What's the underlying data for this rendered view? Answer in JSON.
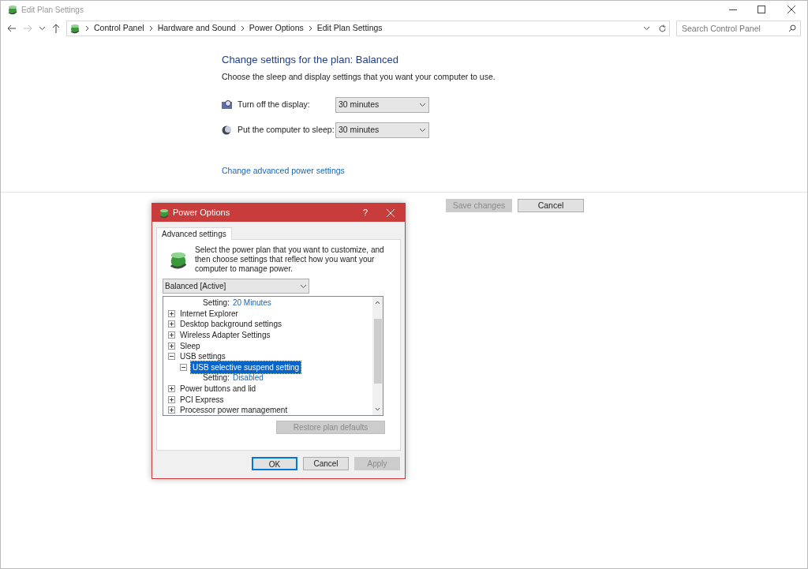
{
  "window": {
    "title": "Edit Plan Settings"
  },
  "breadcrumb": [
    "Control Panel",
    "Hardware and Sound",
    "Power Options",
    "Edit Plan Settings"
  ],
  "search": {
    "placeholder": "Search Control Panel"
  },
  "heading": "Change settings for the plan: Balanced",
  "subheading": "Choose the sleep and display settings that you want your computer to use.",
  "settings": [
    {
      "kind": "display",
      "label": "Turn off the display:",
      "value": "30 minutes"
    },
    {
      "kind": "sleep",
      "label": "Put the computer to sleep:",
      "value": "30 minutes"
    }
  ],
  "advanced_link": "Change advanced power settings",
  "buttons": [
    {
      "label": "Save changes",
      "disabled": true
    },
    {
      "label": "Cancel",
      "disabled": false
    }
  ],
  "dialog": {
    "title": "Power Options",
    "help": "?",
    "tabs": [
      {
        "label": "Advanced settings",
        "selected": true
      }
    ],
    "intro": "Select the power plan that you want to customize, and then choose settings that reflect how you want your computer to manage power.",
    "plan": "Balanced [Active]",
    "tree": [
      {
        "kind": "setting",
        "label": "Setting:",
        "value": "20 Minutes"
      },
      {
        "kind": "node",
        "label": "Internet Explorer",
        "expanded": false,
        "selected": false
      },
      {
        "kind": "node",
        "label": "Desktop background settings",
        "expanded": false,
        "selected": false
      },
      {
        "kind": "node",
        "label": "Wireless Adapter Settings",
        "expanded": false,
        "selected": false
      },
      {
        "kind": "node",
        "label": "Sleep",
        "expanded": false,
        "selected": false
      },
      {
        "kind": "node",
        "label": "USB settings",
        "expanded": true,
        "selected": false,
        "children": [
          {
            "kind": "node",
            "label": "USB selective suspend setting",
            "expanded": true,
            "selected": true,
            "children": [
              {
                "kind": "setting",
                "label": "Setting:",
                "value": "Disabled"
              }
            ]
          }
        ]
      },
      {
        "kind": "node",
        "label": "Power buttons and lid",
        "expanded": false,
        "selected": false
      },
      {
        "kind": "node",
        "label": "PCI Express",
        "expanded": false,
        "selected": false
      },
      {
        "kind": "node",
        "label": "Processor power management",
        "expanded": false,
        "selected": false
      }
    ],
    "restore": {
      "label": "Restore plan defaults",
      "disabled": true
    },
    "buttons": [
      {
        "label": "OK",
        "disabled": false,
        "default": true
      },
      {
        "label": "Cancel",
        "disabled": false,
        "default": false
      },
      {
        "label": "Apply",
        "disabled": true,
        "default": false
      }
    ]
  }
}
